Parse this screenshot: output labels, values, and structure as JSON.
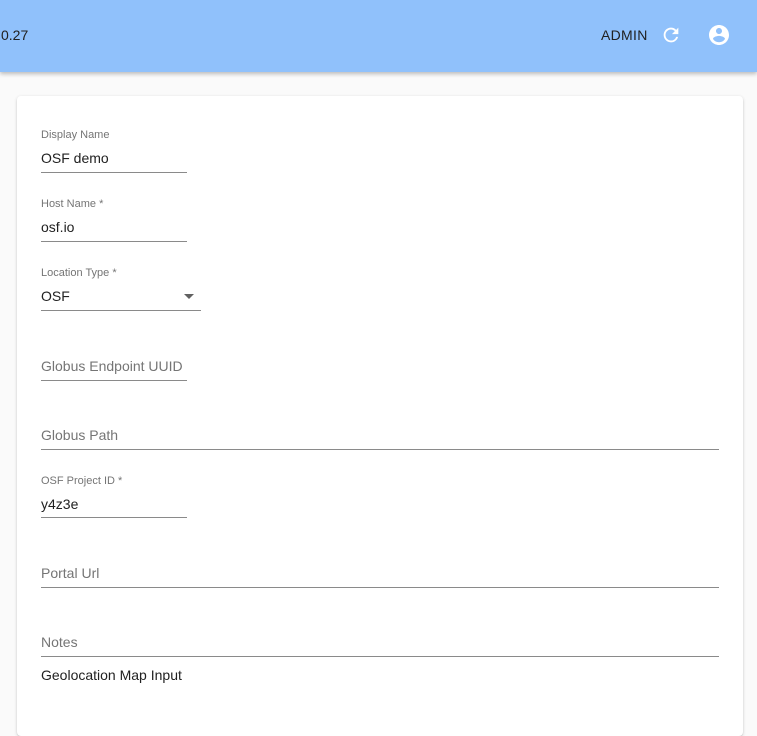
{
  "appbar": {
    "version": "0.27",
    "user_label": "ADMIN",
    "refresh_icon": "refresh-icon",
    "account_icon": "account-circle-icon",
    "background": "#90c1fb"
  },
  "form": {
    "display_name": {
      "label": "Display Name",
      "value": "OSF demo"
    },
    "host_name": {
      "label": "Host Name *",
      "value": "osf.io"
    },
    "location_type": {
      "label": "Location Type *",
      "value": "OSF"
    },
    "globus_endpoint_uuid": {
      "placeholder": "Globus Endpoint UUID"
    },
    "globus_path": {
      "placeholder": "Globus Path"
    },
    "osf_project_id": {
      "label": "OSF Project ID *",
      "value": "y4z3e"
    },
    "portal_url": {
      "placeholder": "Portal Url"
    },
    "notes": {
      "placeholder": "Notes"
    },
    "geolocation_title": "Geolocation Map Input"
  }
}
